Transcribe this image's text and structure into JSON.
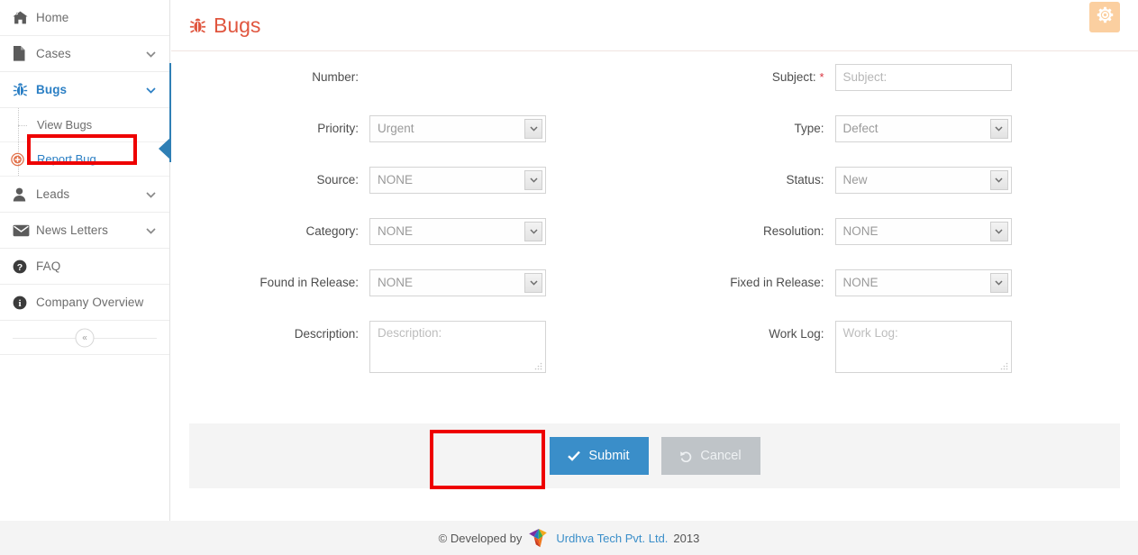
{
  "sidebar": {
    "items": [
      {
        "label": "Home",
        "icon": "home-icon",
        "expandable": false,
        "active": false
      },
      {
        "label": "Cases",
        "icon": "document-icon",
        "expandable": true,
        "active": false
      },
      {
        "label": "Bugs",
        "icon": "bug-icon",
        "expandable": true,
        "active": true
      }
    ],
    "sub_items": [
      {
        "label": "View Bugs",
        "icon": "none",
        "active": false
      },
      {
        "label": "Report Bug",
        "icon": "plus-circle-icon",
        "active": true
      }
    ],
    "items_after": [
      {
        "label": "Leads",
        "icon": "user-icon",
        "expandable": true,
        "active": false
      },
      {
        "label": "News Letters",
        "icon": "envelope-icon",
        "expandable": true,
        "active": false
      },
      {
        "label": "FAQ",
        "icon": "question-circle-icon",
        "expandable": false,
        "active": false
      },
      {
        "label": "Company Overview",
        "icon": "info-circle-icon",
        "expandable": false,
        "active": false
      }
    ],
    "collapse_label": "«"
  },
  "header": {
    "title": "Bugs",
    "title_icon": "bug-icon",
    "settings_icon": "gear-icon"
  },
  "form": {
    "fields": {
      "number": {
        "label": "Number:",
        "value": ""
      },
      "subject": {
        "label": "Subject:",
        "required_mark": "*",
        "placeholder": "Subject:",
        "value": ""
      },
      "priority": {
        "label": "Priority:",
        "value": "Urgent"
      },
      "type": {
        "label": "Type:",
        "value": "Defect"
      },
      "source": {
        "label": "Source:",
        "value": "NONE"
      },
      "status": {
        "label": "Status:",
        "value": "New"
      },
      "category": {
        "label": "Category:",
        "value": "NONE"
      },
      "resolution": {
        "label": "Resolution:",
        "value": "NONE"
      },
      "found_in_release": {
        "label": "Found in Release:",
        "value": "NONE"
      },
      "fixed_in_release": {
        "label": "Fixed in Release:",
        "value": "NONE"
      },
      "description": {
        "label": "Description:",
        "placeholder": "Description:",
        "value": ""
      },
      "work_log": {
        "label": "Work Log:",
        "placeholder": "Work Log:",
        "value": ""
      }
    }
  },
  "actions": {
    "submit_label": "Submit",
    "submit_icon": "check-icon",
    "cancel_label": "Cancel",
    "cancel_icon": "undo-icon"
  },
  "footer": {
    "prefix": "© Developed by",
    "company": "Urdhva Tech Pvt. Ltd.",
    "year": "2013",
    "logo_icon": "urdhva-fan-logo"
  },
  "colors": {
    "accent_blue": "#3a8ec9",
    "title_red": "#e0563f",
    "annotation_red": "#ee0000",
    "gear_bg": "#fbcfa0",
    "cancel_gray": "#bfc4c8",
    "panel_gray": "#f4f4f4"
  }
}
